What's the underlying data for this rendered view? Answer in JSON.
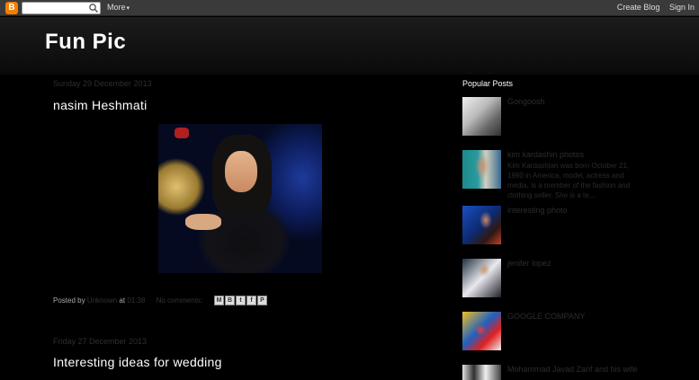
{
  "navbar": {
    "logo_letter": "B",
    "search_placeholder": "",
    "more_label": "More",
    "create_blog": "Create Blog",
    "sign_in": "Sign In"
  },
  "header": {
    "title": "Fun Pic"
  },
  "posts": [
    {
      "date": "Sunday 29 December 2013",
      "title": "nasim Heshmati",
      "footer": {
        "posted_by": "Posted by",
        "author": "Unknown",
        "at": "at",
        "time": "01:38",
        "comments": "No comments:"
      },
      "share": [
        "M",
        "B",
        "t",
        "f",
        "P"
      ]
    },
    {
      "date": "Friday 27 December 2013",
      "title": "Interesting ideas for wedding"
    }
  ],
  "sidebar": {
    "title": "Popular Posts",
    "items": [
      {
        "title": "Gongoosh",
        "snippet": ""
      },
      {
        "title": "kim kardashin photos",
        "snippet": "Kim Kardashian was born October 21, 1980 in America, model, actress and media, is a member of the fashion and clothing seller. She is a te..."
      },
      {
        "title": "interesting photo",
        "snippet": ""
      },
      {
        "title": "jenifer lopez",
        "snippet": ""
      },
      {
        "title": "GOOGLE COMPANY",
        "snippet": ""
      },
      {
        "title": "Mohammad Javad Zarif and his wife",
        "snippet": ""
      }
    ]
  }
}
